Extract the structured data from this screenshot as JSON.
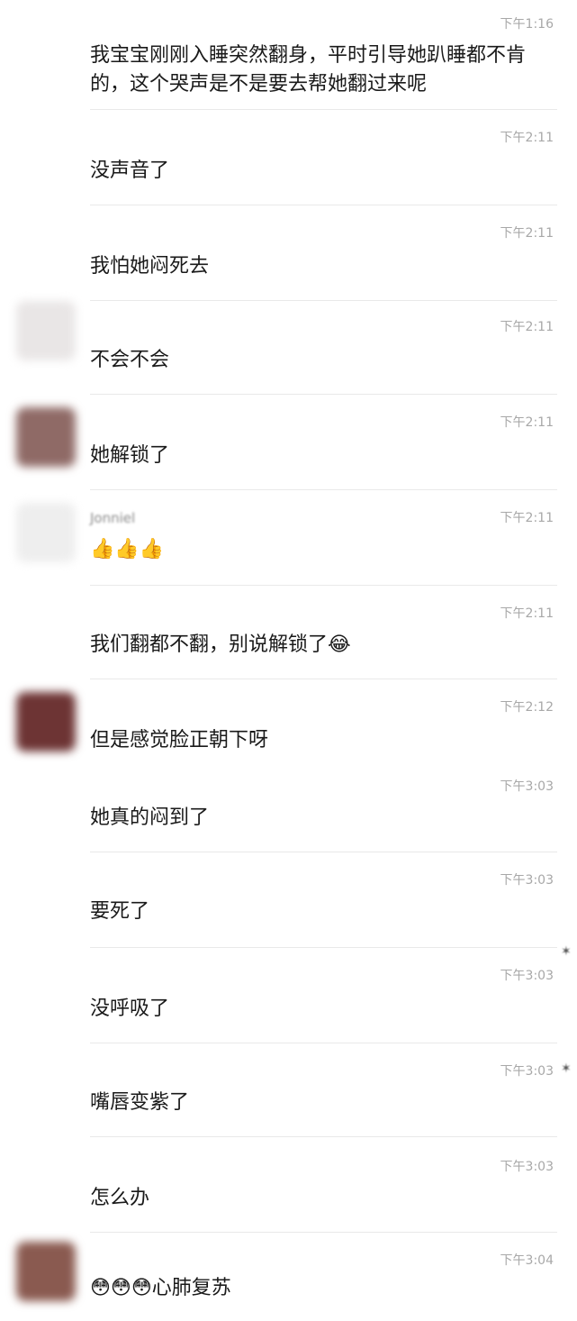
{
  "messages": [
    {
      "sender": "",
      "time": "下午1:16",
      "text": "我宝宝刚刚入睡突然翻身，平时引导她趴睡都不肯的，这个哭声是不是要去帮她翻过来呢"
    },
    {
      "sender": "",
      "time": "下午2:11",
      "text": "没声音了"
    },
    {
      "sender": "",
      "time": "下午2:11",
      "text": "我怕她闷死去"
    },
    {
      "sender": "",
      "time": "下午2:11",
      "text": "不会不会"
    },
    {
      "sender": "",
      "time": "下午2:11",
      "text": "她解锁了"
    },
    {
      "sender": "Jonniel",
      "time": "下午2:11",
      "text": "👍👍👍"
    },
    {
      "sender": "",
      "time": "下午2:11",
      "text": "我们翻都不翻，别说解锁了😂"
    },
    {
      "sender": "",
      "time": "下午2:12",
      "text": "但是感觉脸正朝下呀"
    },
    {
      "sender": "",
      "time": "下午3:03",
      "text": "她真的闷到了"
    },
    {
      "sender": "",
      "time": "下午3:03",
      "text": "要死了"
    },
    {
      "sender": "",
      "time": "下午3:03",
      "text": "没呼吸了"
    },
    {
      "sender": "",
      "time": "下午3:03",
      "text": "嘴唇变紫了"
    },
    {
      "sender": "",
      "time": "下午3:03",
      "text": "怎么办"
    },
    {
      "sender": "",
      "time": "下午3:04",
      "text": "😳😳😳心肺复苏"
    }
  ],
  "avatars": {
    "colors": [
      "#e9e6e6",
      "#8f6a66",
      "#eeeeee",
      "#6d3434",
      "#8a5a50"
    ]
  },
  "icons": {
    "thumbs_up": "thumbs-up-emoji",
    "laughing": "laughing-tears-emoji",
    "flushed": "flushed-face-emoji"
  }
}
